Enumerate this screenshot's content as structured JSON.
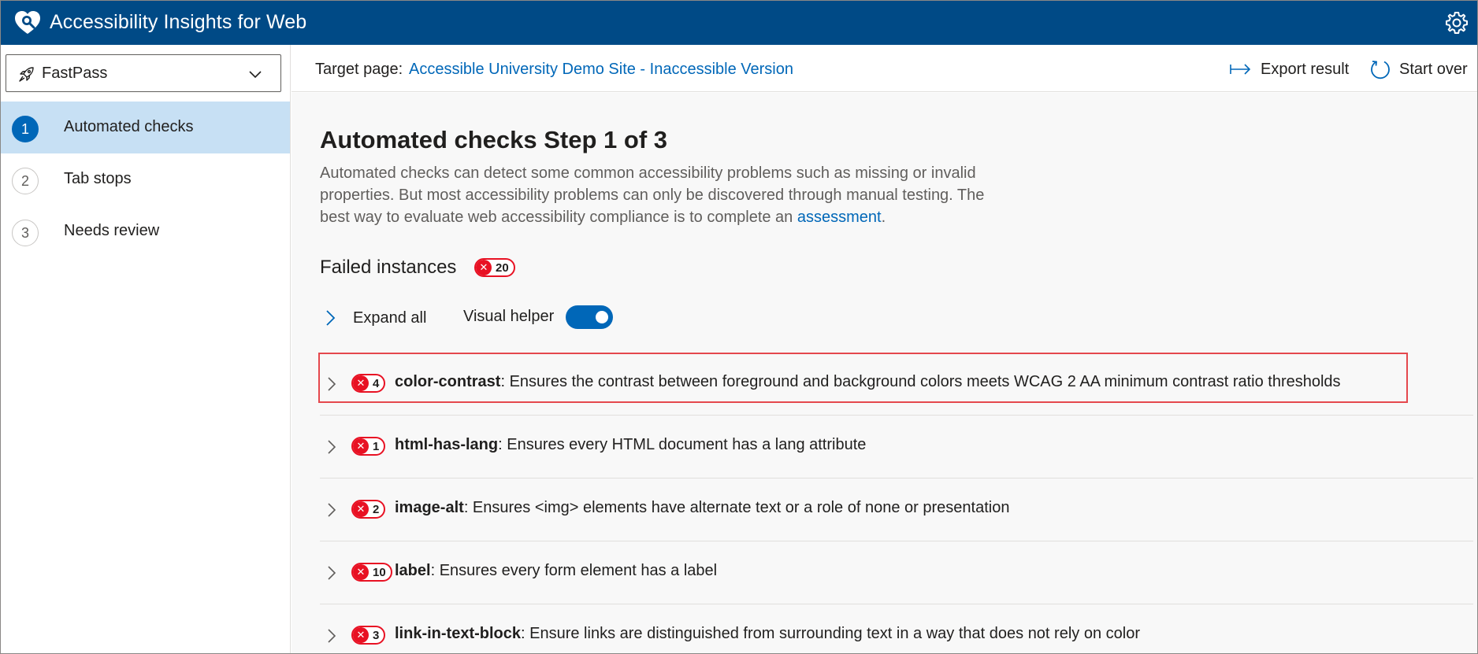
{
  "app": {
    "title": "Accessibility Insights for Web"
  },
  "nav": {
    "mode": "FastPass",
    "items": [
      {
        "num": "1",
        "label": "Automated checks",
        "selected": true
      },
      {
        "num": "2",
        "label": "Tab stops",
        "selected": false
      },
      {
        "num": "3",
        "label": "Needs review",
        "selected": false
      }
    ]
  },
  "command_bar": {
    "target_label": "Target page:",
    "target_link": "Accessible University Demo Site - Inaccessible Version",
    "export_label": "Export result",
    "start_over_label": "Start over"
  },
  "main": {
    "title": "Automated checks Step 1 of 3",
    "description_text": "Automated checks can detect some common accessibility problems such as missing or invalid properties. But most accessibility problems can only be discovered through manual testing. The best way to evaluate web accessibility compliance is to complete an ",
    "description_link": "assessment",
    "description_end": ".",
    "failed_header": "Failed instances",
    "failed_count": "20",
    "expand_all": "Expand all",
    "visual_helper": "Visual helper",
    "visual_helper_on": true,
    "rules": [
      {
        "name": "color-contrast",
        "count": "4",
        "desc": ": Ensures the contrast between foreground and background colors meets WCAG 2 AA minimum contrast ratio thresholds",
        "highlighted": true
      },
      {
        "name": "html-has-lang",
        "count": "1",
        "desc": ": Ensures every HTML document has a lang attribute",
        "highlighted": false
      },
      {
        "name": "image-alt",
        "count": "2",
        "desc": ": Ensures <img> elements have alternate text or a role of none or presentation",
        "highlighted": false
      },
      {
        "name": "label",
        "count": "10",
        "desc": ": Ensures every form element has a label",
        "highlighted": false
      },
      {
        "name": "link-in-text-block",
        "count": "3",
        "desc": ": Ensure links are distinguished from surrounding text in a way that does not rely on color",
        "highlighted": false
      }
    ]
  },
  "colors": {
    "topbar": "#004a86",
    "accent": "#0067b8",
    "selected_nav": "#c7e0f4",
    "error": "#e81123",
    "highlight_outline": "#e5484d"
  },
  "icons": {
    "brand": "heart-shield-icon",
    "settings": "gear-icon",
    "mode": "rocket-icon",
    "dropdown": "chevron-down-icon",
    "export": "export-arrow-icon",
    "start_over": "refresh-icon",
    "expand": "chevron-right-icon",
    "failure": "x-circle-icon"
  }
}
